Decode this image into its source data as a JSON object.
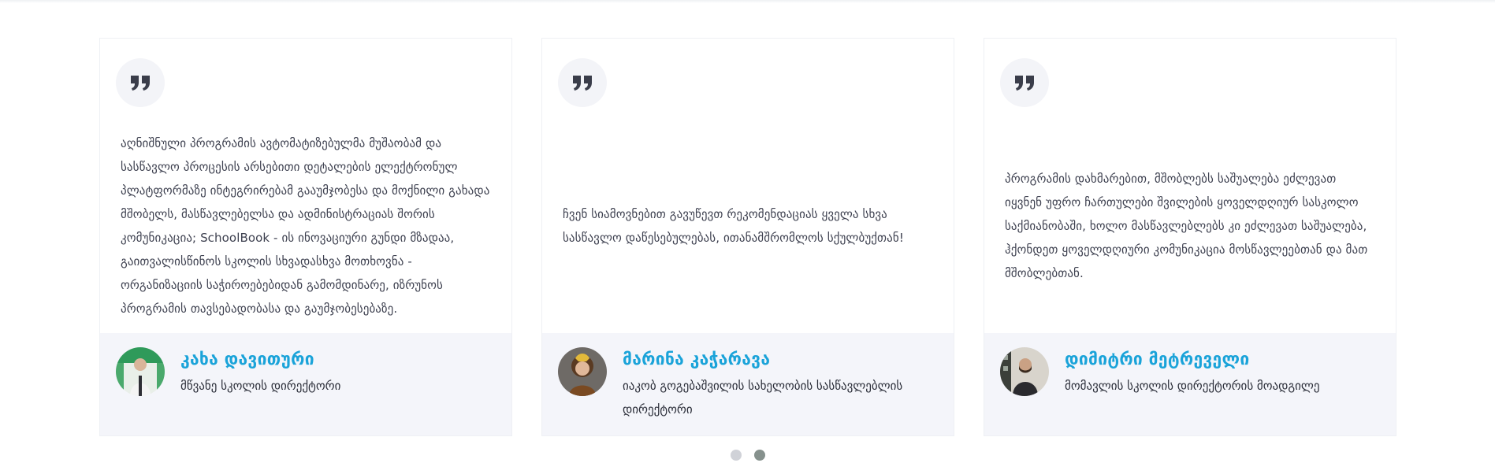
{
  "testimonials": [
    {
      "quote": "აღნიშნული პროგრამის ავტომატიზებულმა მუშაობამ და სასწავლო პროცესის არსებითი დეტალების ელექტრონულ პლატფორმაზე ინტეგრირებამ გააუმჯობესა და მოქნილი გახადა მშობელს, მასწავლებელსა და ადმინისტრაციას შორის კომუნიკაცია; SchoolBook - ის ინოვაციური გუნდი მზადაა, გაითვალისწინოს სკოლის სხვადასხვა მოთხოვნა - ორგანიზაციის საჭიროებებიდან გამომდინარე, იზრუნოს პროგრამის თავსებადობასა და გაუმჯობესებაზე.",
      "name": "კახა დავითური",
      "role": "მწვანე სკოლის დირექტორი",
      "avatar_bg": "#2f9a5a"
    },
    {
      "quote": "ჩვენ სიამოვნებით გავუწევთ რეკომენდაციას ყველა სხვა სასწავლო დაწესებულებას, ითანამშრომლოს სქულბუქთან!",
      "name": "მარინა კაჭარავა",
      "role": "იაკობ გოგებაშვილის სახელობის სასწავლებლის დირექტორი",
      "avatar_bg": "#5a4a3e"
    },
    {
      "quote": "პროგრამის დახმარებით, მშობლებს საშუალება ეძლევათ იყვნენ უფრო ჩართულები შვილების ყოველდღიურ სასკოლო საქმიანობაში, ხოლო მასწავლებლებს კი ეძლევათ საშუალება, ჰქონდეთ ყოველდღიური კომუნიკაცია მოსწავლეებთან და მათ მშობლებთან.",
      "name": "დიმიტრი მეტრეველი",
      "role": "მომავლის სკოლის დირექტორის მოადგილე",
      "avatar_bg": "#3b3f3a"
    }
  ],
  "icons": {
    "quote": "quote-icon"
  },
  "colors": {
    "accent": "#1aa3d9",
    "quote_badge": "#f3f4f8",
    "author_panel": "#f4f5fa"
  },
  "carousel": {
    "pages": 2,
    "active_page": 2
  }
}
